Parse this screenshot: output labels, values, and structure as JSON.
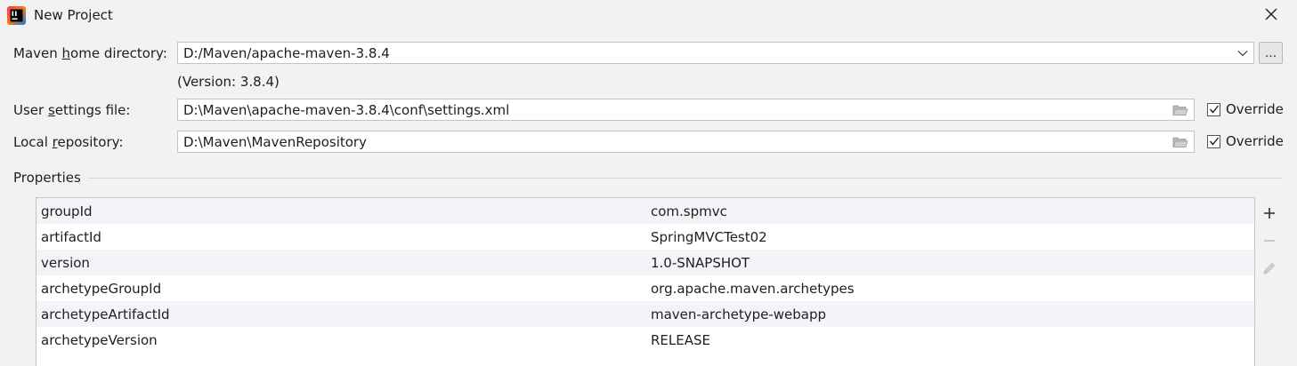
{
  "window": {
    "title": "New Project"
  },
  "maven_home": {
    "label_pre": "Maven ",
    "label_mnemonic": "h",
    "label_post": "ome directory:",
    "value": "D:/Maven/apache-maven-3.8.4",
    "browse_label": "...",
    "version_note": "(Version: 3.8.4)"
  },
  "user_settings": {
    "label_pre": "User ",
    "label_mnemonic": "s",
    "label_post": "ettings file:",
    "value": "D:\\Maven\\apache-maven-3.8.4\\conf\\settings.xml",
    "override_label": "Override",
    "override_checked": true
  },
  "local_repo": {
    "label_pre": "Local ",
    "label_mnemonic": "r",
    "label_post": "epository:",
    "value": "D:\\Maven\\MavenRepository",
    "override_label": "Override",
    "override_checked": true
  },
  "properties": {
    "title": "Properties",
    "rows": [
      {
        "key": "groupId",
        "value": "com.spmvc"
      },
      {
        "key": "artifactId",
        "value": "SpringMVCTest02"
      },
      {
        "key": "version",
        "value": "1.0-SNAPSHOT"
      },
      {
        "key": "archetypeGroupId",
        "value": "org.apache.maven.archetypes"
      },
      {
        "key": "archetypeArtifactId",
        "value": "maven-archetype-webapp"
      },
      {
        "key": "archetypeVersion",
        "value": "RELEASE"
      }
    ]
  },
  "icons": {
    "app": "intellij-icon",
    "close": "close-icon",
    "dropdown": "chevron-down-icon",
    "folder": "folder-icon",
    "add": "plus-icon",
    "remove": "minus-icon",
    "edit": "pencil-icon"
  },
  "colors": {
    "background": "#f2f2f2",
    "field_bg": "#ffffff",
    "selected_row": "#f2f4f7"
  }
}
